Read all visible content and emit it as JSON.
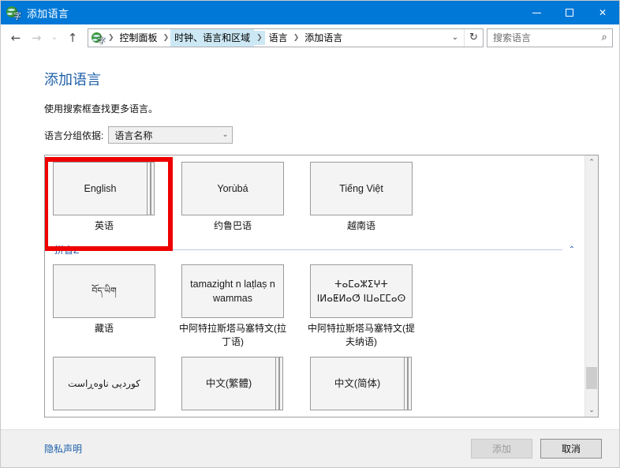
{
  "window": {
    "title": "添加语言",
    "icon": "language-globe-icon",
    "caption": {
      "minimize": "minimize-button",
      "maximize": "maximize-button",
      "close": "close-button"
    },
    "accent_color": "#0078d7"
  },
  "nav": {
    "back": "←",
    "forward": "→",
    "recent": "⌄",
    "up": "↑",
    "breadcrumbs": [
      {
        "label": "控制面板",
        "highlighted": false
      },
      {
        "label": "时钟、语言和区域",
        "highlighted": true
      },
      {
        "label": "语言",
        "highlighted": false
      },
      {
        "label": "添加语言",
        "highlighted": false
      }
    ],
    "address_chevron": "⌄",
    "refresh": "↻",
    "search_placeholder": "搜索语言",
    "search_value": "",
    "search_icon": "🔍"
  },
  "page": {
    "title": "添加语言",
    "subtitle": "使用搜索框查找更多语言。",
    "groupby_label": "语言分组依据:",
    "groupby_value": "语言名称",
    "groupby_chevron": "⌄"
  },
  "list": {
    "rows": [
      {
        "tiles": [
          {
            "native": "English",
            "label": "英语",
            "stacked": true,
            "script": "latin",
            "annotated": true
          },
          {
            "native": "Yorùbá",
            "label": "约鲁巴语",
            "stacked": false,
            "script": "latin",
            "annotated": false
          },
          {
            "native": "Tiếng Việt",
            "label": "越南语",
            "stacked": false,
            "script": "latin",
            "annotated": false
          }
        ]
      }
    ],
    "group": {
      "name": "拼音Z",
      "collapse_chevron": "⌃",
      "rows": [
        {
          "tiles": [
            {
              "native": "བོད་ཡིག",
              "label": "藏语",
              "stacked": false,
              "script": "tibetan",
              "annotated": false
            },
            {
              "native": "tamazight n laṭlaṣ n wammas",
              "label": "中阿特拉斯塔马塞特文(拉丁语)",
              "stacked": false,
              "script": "latin",
              "annotated": false
            },
            {
              "native": "ⵜⴰⵎⴰⵣⵉⵖⵜ ⵏⵍⴰⵟⵍⴰⵚ ⵏⵡⴰⵎⵎⴰⵙ",
              "label": "中阿特拉斯塔马塞特文(提夫纳语)",
              "stacked": false,
              "script": "tifinagh",
              "annotated": false
            }
          ]
        },
        {
          "tiles": [
            {
              "native": "کوردیی ناوەڕاست",
              "label": "",
              "stacked": false,
              "script": "arabic",
              "annotated": false
            },
            {
              "native": "中文(繁體)",
              "label": "",
              "stacked": true,
              "script": "han",
              "annotated": false
            },
            {
              "native": "中文(简体)",
              "label": "",
              "stacked": true,
              "script": "han",
              "annotated": false
            }
          ]
        }
      ]
    },
    "scrollbar": {
      "up_arrow": "⌃",
      "down_arrow": "⌄",
      "thumb_position": "bottom"
    }
  },
  "footer": {
    "privacy_link": "隐私声明",
    "add_button": "添加",
    "add_enabled": false,
    "cancel_button": "取消"
  },
  "annotation": {
    "color": "#ee0000",
    "target": "English"
  }
}
